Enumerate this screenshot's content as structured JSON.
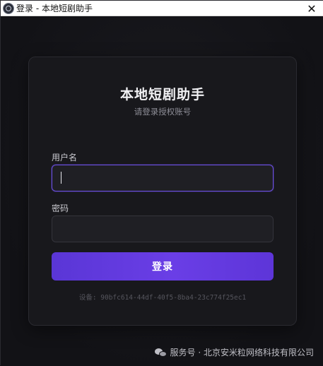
{
  "window": {
    "title": "登录 - 本地短剧助手",
    "close_glyph": "✕"
  },
  "card": {
    "title": "本地短剧助手",
    "subtitle": "请登录授权账号"
  },
  "form": {
    "username_label": "用户名",
    "username_value": "",
    "password_label": "密码",
    "password_value": "",
    "login_button": "登录"
  },
  "device_id": "设备: 90bfc614-44df-40f5-8ba4-23c774f25ec1",
  "watermark": {
    "icon": "wechat-icon",
    "text": "服务号 · 北京安米粒网络科技有限公司"
  },
  "colors": {
    "accent": "#6a3ee6",
    "focus_border": "#6a4fe0",
    "background": "#141418",
    "card": "#18181c"
  }
}
